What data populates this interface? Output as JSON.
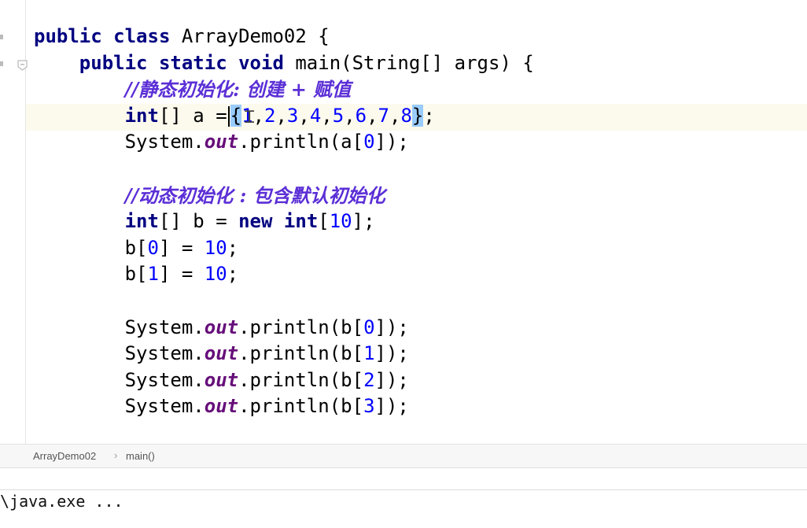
{
  "editor": {
    "lines": [
      [
        {
          "t": "public",
          "c": "kw"
        },
        {
          "t": " "
        },
        {
          "t": "class",
          "c": "kw"
        },
        {
          "t": " ArrayDemo02 {"
        }
      ],
      [
        {
          "t": "    "
        },
        {
          "t": "public",
          "c": "kw"
        },
        {
          "t": " "
        },
        {
          "t": "static",
          "c": "kw"
        },
        {
          "t": " "
        },
        {
          "t": "void",
          "c": "kw"
        },
        {
          "t": " main(String[] args) {"
        }
      ],
      [
        {
          "t": "        "
        },
        {
          "t": "//静态初始化: 创建 + 赋值",
          "c": "cmt"
        }
      ],
      [
        {
          "t": "        "
        },
        {
          "t": "int",
          "c": "kw"
        },
        {
          "t": "[] a ="
        },
        {
          "t": "",
          "c": "caret"
        },
        {
          "t": "{",
          "c": "brace-hl"
        },
        {
          "t": "1",
          "c": "num"
        },
        {
          "t": ","
        },
        {
          "t": "2",
          "c": "num"
        },
        {
          "t": ","
        },
        {
          "t": "3",
          "c": "num"
        },
        {
          "t": ","
        },
        {
          "t": "4",
          "c": "num"
        },
        {
          "t": ","
        },
        {
          "t": "5",
          "c": "num"
        },
        {
          "t": ","
        },
        {
          "t": "6",
          "c": "num"
        },
        {
          "t": ","
        },
        {
          "t": "7",
          "c": "num"
        },
        {
          "t": ","
        },
        {
          "t": "8",
          "c": "num"
        },
        {
          "t": "}",
          "c": "brace-hl"
        },
        {
          "t": ";"
        }
      ],
      [
        {
          "t": "        System."
        },
        {
          "t": "out",
          "c": "fld"
        },
        {
          "t": ".println(a["
        },
        {
          "t": "0",
          "c": "num"
        },
        {
          "t": "]);"
        }
      ],
      [
        {
          "t": ""
        }
      ],
      [
        {
          "t": "        "
        },
        {
          "t": "//动态初始化 : 包含默认初始化",
          "c": "cmt"
        }
      ],
      [
        {
          "t": "        "
        },
        {
          "t": "int",
          "c": "kw"
        },
        {
          "t": "[] b = "
        },
        {
          "t": "new",
          "c": "kw"
        },
        {
          "t": " "
        },
        {
          "t": "int",
          "c": "kw"
        },
        {
          "t": "["
        },
        {
          "t": "10",
          "c": "num"
        },
        {
          "t": "];"
        }
      ],
      [
        {
          "t": "        b["
        },
        {
          "t": "0",
          "c": "num"
        },
        {
          "t": "] = "
        },
        {
          "t": "10",
          "c": "num"
        },
        {
          "t": ";"
        }
      ],
      [
        {
          "t": "        b["
        },
        {
          "t": "1",
          "c": "num"
        },
        {
          "t": "] = "
        },
        {
          "t": "10",
          "c": "num"
        },
        {
          "t": ";"
        }
      ],
      [
        {
          "t": ""
        }
      ],
      [
        {
          "t": "        System."
        },
        {
          "t": "out",
          "c": "fld"
        },
        {
          "t": ".println(b["
        },
        {
          "t": "0",
          "c": "num"
        },
        {
          "t": "]);"
        }
      ],
      [
        {
          "t": "        System."
        },
        {
          "t": "out",
          "c": "fld"
        },
        {
          "t": ".println(b["
        },
        {
          "t": "1",
          "c": "num"
        },
        {
          "t": "]);"
        }
      ],
      [
        {
          "t": "        System."
        },
        {
          "t": "out",
          "c": "fld"
        },
        {
          "t": ".println(b["
        },
        {
          "t": "2",
          "c": "num"
        },
        {
          "t": "]);"
        }
      ],
      [
        {
          "t": "        System."
        },
        {
          "t": "out",
          "c": "fld"
        },
        {
          "t": ".println(b["
        },
        {
          "t": "3",
          "c": "num"
        },
        {
          "t": "]);"
        }
      ]
    ]
  },
  "breadcrumb": {
    "class_name": "ArrayDemo02",
    "separator": "›",
    "method_name": "main()"
  },
  "console": {
    "text": "\\java.exe ..."
  },
  "colors": {
    "keyword": "#000080",
    "number": "#0000ff",
    "field": "#660e7a",
    "comment": "#5b2fd6",
    "current_line": "#fcfaed",
    "brace_match": "#99ccff"
  }
}
